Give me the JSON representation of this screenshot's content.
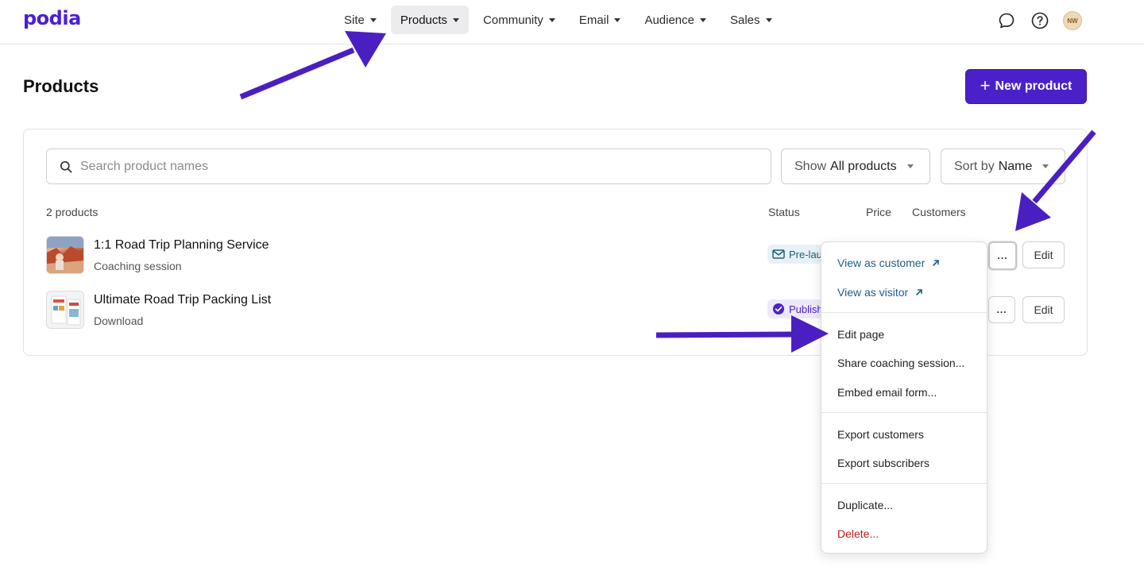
{
  "brand": {
    "logo_text": "podia",
    "accent": "#4a21c9"
  },
  "nav": {
    "items": [
      {
        "label": "Site",
        "active": false
      },
      {
        "label": "Products",
        "active": true
      },
      {
        "label": "Community",
        "active": false
      },
      {
        "label": "Email",
        "active": false
      },
      {
        "label": "Audience",
        "active": false
      },
      {
        "label": "Sales",
        "active": false
      }
    ]
  },
  "header_icons": {
    "chat": "chat-bubble-icon",
    "help": "question-circle-icon",
    "avatar_initials": "NW"
  },
  "page": {
    "title": "Products",
    "new_button": "New product"
  },
  "search": {
    "placeholder": "Search product names",
    "value": ""
  },
  "filters": {
    "show_prefix": "Show",
    "show_value": "All products",
    "sort_prefix": "Sort by",
    "sort_value": "Name"
  },
  "table": {
    "count": "2 products",
    "columns": [
      "Status",
      "Price",
      "Customers"
    ],
    "rows": [
      {
        "name": "1:1 Road Trip Planning Service",
        "type": "Coaching session",
        "status": "Pre-launch",
        "status_icon": "envelope-icon",
        "actions": "...",
        "edit": "Edit"
      },
      {
        "name": "Ultimate Road Trip Packing List",
        "type": "Download",
        "status": "Published",
        "status_icon": "check-circle-icon",
        "actions": "...",
        "edit": "Edit"
      }
    ]
  },
  "menu": {
    "items": [
      {
        "label": "View as customer",
        "kind": "link"
      },
      {
        "label": "View as visitor",
        "kind": "link"
      },
      {
        "label": "Edit page",
        "kind": "normal"
      },
      {
        "label": "Share coaching session...",
        "kind": "normal"
      },
      {
        "label": "Embed email form...",
        "kind": "normal"
      },
      {
        "label": "Export customers",
        "kind": "normal"
      },
      {
        "label": "Export subscribers",
        "kind": "normal"
      },
      {
        "label": "Duplicate...",
        "kind": "normal"
      },
      {
        "label": "Delete...",
        "kind": "danger"
      }
    ]
  },
  "annotation_color": "#4a1fc2"
}
